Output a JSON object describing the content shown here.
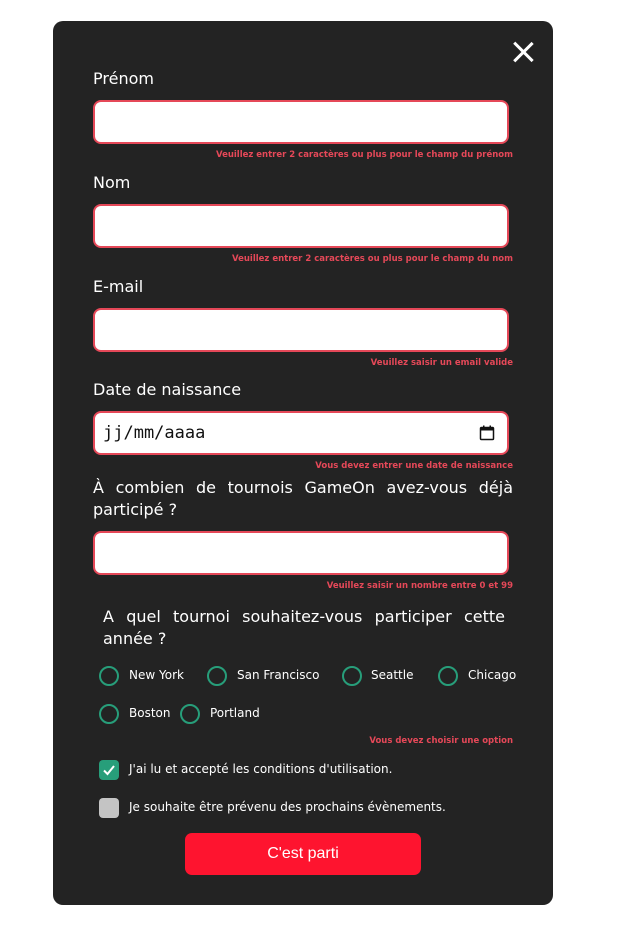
{
  "form": {
    "first_name": {
      "label": "Prénom",
      "value": "",
      "error": "Veuillez entrer 2 caractères ou plus pour le champ du prénom"
    },
    "last_name": {
      "label": "Nom",
      "value": "",
      "error": "Veuillez entrer 2 caractères ou plus pour le champ du nom"
    },
    "email": {
      "label": "E-mail",
      "value": "",
      "error": "Veuillez saisir un email valide"
    },
    "birthdate": {
      "label": "Date de naissance",
      "placeholder": "jj/mm/aaaa",
      "icon": "calendar-icon",
      "error": "Vous devez entrer une date de naissance"
    },
    "quantity": {
      "label": "À combien de tournois GameOn avez-vous déjà participé ?",
      "value": "",
      "error": "Veuillez saisir un nombre entre 0 et 99"
    },
    "location": {
      "question": "A quel tournoi souhaitez-vous participer cette année ?",
      "options": [
        "New York",
        "San Francisco",
        "Seattle",
        "Chicago",
        "Boston",
        "Portland"
      ],
      "error": "Vous devez choisir une option"
    },
    "terms": {
      "label": "J'ai lu et accepté les conditions d'utilisation.",
      "checked": true
    },
    "newsletter": {
      "label": "Je souhaite être prévenu des prochains évènements.",
      "checked": false
    },
    "submit_label": "C'est parti"
  },
  "colors": {
    "accent": "#fe142f",
    "error": "#e54858",
    "radio": "#279e7a",
    "background": "#232323"
  }
}
